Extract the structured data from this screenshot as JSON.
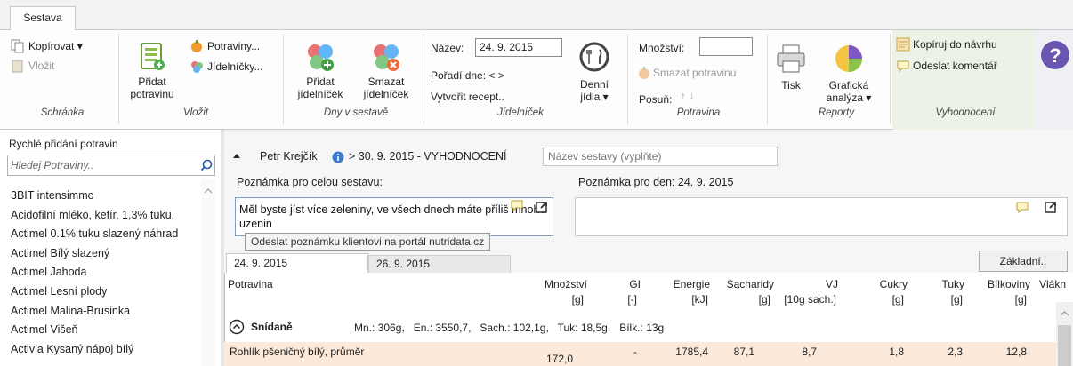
{
  "ribbon": {
    "tab": "Sestava",
    "groups": {
      "schranka": "Schránka",
      "vlozit": "Vložit",
      "dny": "Dny v sestavě",
      "jidelnicek": "Jídelníček",
      "potravina": "Potravina",
      "reporty": "Reporty",
      "vyhodnoceni": "Vyhodnocení"
    },
    "copy": "Kopírovat ▾",
    "paste": "Vložit",
    "add_food": [
      "Přidat",
      "potravinu"
    ],
    "foods": "Potraviny...",
    "menus": "Jídelníčky...",
    "add_menu": [
      "Přidat",
      "jídelníček"
    ],
    "delete_menu": [
      "Smazat",
      "jídelníček"
    ],
    "name_label": "Název:",
    "name_value": "24. 9. 2015",
    "day_order": "Pořadí dne:  <  >",
    "create_recipe": "Vytvořit recept..",
    "daily_meals": [
      "Denní",
      "jídla ▾"
    ],
    "amount_label": "Množství:",
    "delete_food": "Smazat potravinu",
    "shift": "Posuň:",
    "shift_arrows": "↑ ↓",
    "print": "Tisk",
    "graphic_analysis": [
      "Grafická",
      "analýza ▾"
    ],
    "copy_to_plan": "Kopíruj do návrhu",
    "send_comment": "Odeslat komentář"
  },
  "left_panel": {
    "title": "Rychlé přidání potravin",
    "search_placeholder": "Hledej Potraviny..",
    "foods": [
      "3BIT intensimmo",
      "Acidofilní mléko, kefír, 1,3% tuku,",
      "Actimel 0.1% tuku slazený náhrad",
      "Actimel Bílý slazený",
      "Actimel Jahoda",
      "Actimel Lesní plody",
      "Actimel Malina-Brusinka",
      "Actimel Višeň",
      "Activia Kysaný nápoj bílý"
    ]
  },
  "main": {
    "client": "Petr Krejčík",
    "breadcrumb_rest": "> 30. 9. 2015  - VYHODNOCENÍ",
    "name_placeholder": "Název sestavy (vyplňte)",
    "note_all_label": "Poznámka pro celou sestavu:",
    "note_all_text": "Měl byste jíst více zeleniny, ve všech dnech máte příliš mnoho uzenin",
    "tooltip": "Odeslat poznámku klientovi na portál nutridata.cz",
    "note_day_label": "Poznámka pro den: 24. 9. 2015",
    "day_tabs": [
      "24. 9. 2015",
      "26. 9. 2015"
    ],
    "basic_button": "Základní..",
    "columns": {
      "food": "Potravina",
      "amount": [
        "Množství",
        "[g]"
      ],
      "gi": [
        "GI",
        "[-]"
      ],
      "energy": [
        "Energie",
        "[kJ]"
      ],
      "carbs": [
        "Sacharidy",
        "[g]"
      ],
      "vj": [
        "VJ",
        "[10g sach.]"
      ],
      "sugar": [
        "Cukry",
        "[g]"
      ],
      "fat": [
        "Tuky",
        "[g]"
      ],
      "protein": [
        "Bílkoviny",
        "[g]"
      ],
      "fiber": "Vlákn"
    },
    "meal": {
      "name": "Snídaně",
      "summary": "Mn.: 306g,   En.: 3550,7,   Sach.: 102,1g,   Tuk: 18,5g,   Bílk.: 13g"
    },
    "row": {
      "food": "Rohlík pšeničný bílý,  průměr",
      "amount": "172,0",
      "gi": "-",
      "energy": "1785,4",
      "carbs": "87,1",
      "vj": "8,7",
      "sugar": "1,8",
      "fat": "2,3",
      "protein": "12,8"
    }
  }
}
